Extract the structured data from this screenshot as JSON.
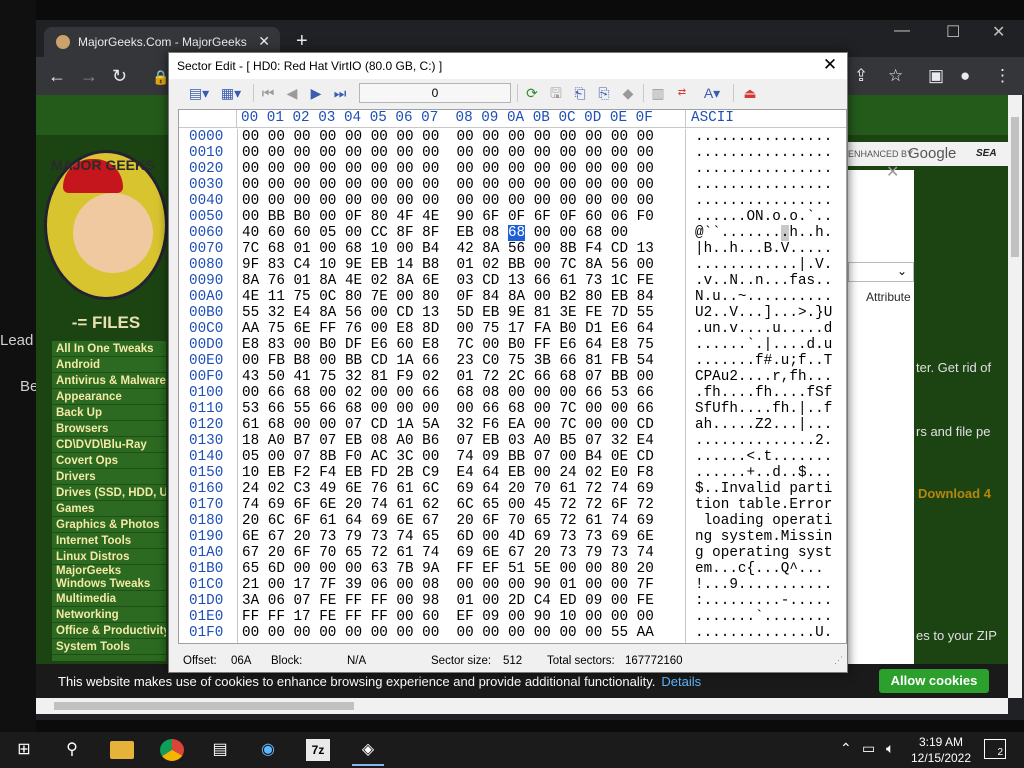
{
  "browser": {
    "tab_title": "MajorGeeks.Com - MajorGeeks",
    "tab_close": "✕",
    "new_tab": "+",
    "back": "←",
    "forward": "→",
    "reload": "↻"
  },
  "site": {
    "logo_text": "MAJOR GEEKS",
    "files_header": "-= FILES",
    "categories": [
      "All In One Tweaks",
      "Android",
      "Antivirus & Malware",
      "Appearance",
      "Back Up",
      "Browsers",
      "CD\\DVD\\Blu-Ray",
      "Covert Ops",
      "Drivers",
      "Drives (SSD, HDD, USB)",
      "Games",
      "Graphics & Photos",
      "Internet Tools",
      "Linux Distros",
      "MajorGeeks Windows Tweaks",
      "Multimedia",
      "Networking",
      "Office & Productivity",
      "System Tools"
    ],
    "search_enhanced": "ENHANCED BY",
    "search_google": "Google",
    "search_label": "SEA",
    "attribute_label": "Attribute",
    "text_fragments": [
      "ter. Get rid of",
      "rs and file pe",
      "Download 4",
      "es to your ZIP"
    ],
    "left_fragments": [
      "Lead",
      "Be"
    ],
    "cookie_message": "This website makes use of cookies to enhance browsing experience and provide additional functionality.",
    "cookie_details": "Details",
    "cookie_allow": "Allow cookies"
  },
  "dialog": {
    "title": "Sector Edit - [ HD0: Red Hat VirtIO (80.0 GB, C:) ]",
    "close": "✕",
    "sector_value": "0",
    "hex_header_columns": "00 01 02 03 04 05 06 07  08 09 0A 0B 0C 0D 0E 0F",
    "ascii_header": "ASCII",
    "rows": [
      {
        "off": "0000",
        "hex": "00 00 00 00 00 00 00 00  00 00 00 00 00 00 00 00",
        "ascii": "................"
      },
      {
        "off": "0010",
        "hex": "00 00 00 00 00 00 00 00  00 00 00 00 00 00 00 00",
        "ascii": "................"
      },
      {
        "off": "0020",
        "hex": "00 00 00 00 00 00 00 00  00 00 00 00 00 00 00 00",
        "ascii": "................"
      },
      {
        "off": "0030",
        "hex": "00 00 00 00 00 00 00 00  00 00 00 00 00 00 00 00",
        "ascii": "................"
      },
      {
        "off": "0040",
        "hex": "00 00 00 00 00 00 00 00  00 00 00 00 00 00 00 00",
        "ascii": "................"
      },
      {
        "off": "0050",
        "hex": "00 BB B0 00 0F 80 4F 4E  90 6F 0F 6F 0F 60 06 F0",
        "ascii": "......ON.o.o.`.."
      },
      {
        "off": "0060",
        "hex": "40 60 60 05 00 CC 8F 8F  EB 08 68 00 00 68 00",
        "ascii": "@``........h..h."
      },
      {
        "off": "0070",
        "hex": "7C 68 01 00 68 10 00 B4  42 8A 56 00 8B F4 CD 13",
        "ascii": "|h..h...B.V....."
      },
      {
        "off": "0080",
        "hex": "9F 83 C4 10 9E EB 14 B8  01 02 BB 00 7C 8A 56 00",
        "ascii": "............|.V."
      },
      {
        "off": "0090",
        "hex": "8A 76 01 8A 4E 02 8A 6E  03 CD 13 66 61 73 1C FE",
        "ascii": ".v..N..n...fas.."
      },
      {
        "off": "00A0",
        "hex": "4E 11 75 0C 80 7E 00 80  0F 84 8A 00 B2 80 EB 84",
        "ascii": "N.u..~.........."
      },
      {
        "off": "00B0",
        "hex": "55 32 E4 8A 56 00 CD 13  5D EB 9E 81 3E FE 7D 55",
        "ascii": "U2..V...]...>.}U"
      },
      {
        "off": "00C0",
        "hex": "AA 75 6E FF 76 00 E8 8D  00 75 17 FA B0 D1 E6 64",
        "ascii": ".un.v....u.....d"
      },
      {
        "off": "00D0",
        "hex": "E8 83 00 B0 DF E6 60 E8  7C 00 B0 FF E6 64 E8 75",
        "ascii": "......`.|....d.u"
      },
      {
        "off": "00E0",
        "hex": "00 FB B8 00 BB CD 1A 66  23 C0 75 3B 66 81 FB 54",
        "ascii": ".......f#.u;f..T"
      },
      {
        "off": "00F0",
        "hex": "43 50 41 75 32 81 F9 02  01 72 2C 66 68 07 BB 00",
        "ascii": "CPAu2....r,fh..."
      },
      {
        "off": "0100",
        "hex": "00 66 68 00 02 00 00 66  68 08 00 00 00 66 53 66",
        "ascii": ".fh....fh....fSf"
      },
      {
        "off": "0110",
        "hex": "53 66 55 66 68 00 00 00  00 66 68 00 7C 00 00 66",
        "ascii": "SfUfh....fh.|..f"
      },
      {
        "off": "0120",
        "hex": "61 68 00 00 07 CD 1A 5A  32 F6 EA 00 7C 00 00 CD",
        "ascii": "ah.....Z2...|..."
      },
      {
        "off": "0130",
        "hex": "18 A0 B7 07 EB 08 A0 B6  07 EB 03 A0 B5 07 32 E4",
        "ascii": "..............2."
      },
      {
        "off": "0140",
        "hex": "05 00 07 8B F0 AC 3C 00  74 09 BB 07 00 B4 0E CD",
        "ascii": "......<.t......."
      },
      {
        "off": "0150",
        "hex": "10 EB F2 F4 EB FD 2B C9  E4 64 EB 00 24 02 E0 F8",
        "ascii": "......+..d..$..."
      },
      {
        "off": "0160",
        "hex": "24 02 C3 49 6E 76 61 6C  69 64 20 70 61 72 74 69",
        "ascii": "$..Invalid parti"
      },
      {
        "off": "0170",
        "hex": "74 69 6F 6E 20 74 61 62  6C 65 00 45 72 72 6F 72",
        "ascii": "tion table.Error"
      },
      {
        "off": "0180",
        "hex": "20 6C 6F 61 64 69 6E 67  20 6F 70 65 72 61 74 69",
        "ascii": " loading operati"
      },
      {
        "off": "0190",
        "hex": "6E 67 20 73 79 73 74 65  6D 00 4D 69 73 73 69 6E",
        "ascii": "ng system.Missin"
      },
      {
        "off": "01A0",
        "hex": "67 20 6F 70 65 72 61 74  69 6E 67 20 73 79 73 74",
        "ascii": "g operating syst"
      },
      {
        "off": "01B0",
        "hex": "65 6D 00 00 00 63 7B 9A  FF EF 51 5E 00 00 80 20",
        "ascii": "em...c{...Q^... "
      },
      {
        "off": "01C0",
        "hex": "21 00 17 7F 39 06 00 08  00 00 00 90 01 00 00 7F",
        "ascii": "!...9..........."
      },
      {
        "off": "01D0",
        "hex": "3A 06 07 FE FF FF 00 98  01 00 2D C4 ED 09 00 FE",
        "ascii": ":.........-....."
      },
      {
        "off": "01E0",
        "hex": "FF FF 17 FE FF FF 00 60  EF 09 00 90 10 00 00 00",
        "ascii": ".......`........"
      },
      {
        "off": "01F0",
        "hex": "00 00 00 00 00 00 00 00  00 00 00 00 00 00 55 AA",
        "ascii": "..............U."
      }
    ],
    "status": {
      "offset_label": "Offset:",
      "offset_value": "06A",
      "block_label": "Block:",
      "block_value": "N/A",
      "sector_size_label": "Sector size:",
      "sector_size_value": "512",
      "total_sectors_label": "Total sectors:",
      "total_sectors_value": "167772160"
    }
  },
  "taskbar": {
    "time": "3:19 AM",
    "date": "12/15/2022",
    "seven_zip": "7z",
    "notifications": "2"
  }
}
